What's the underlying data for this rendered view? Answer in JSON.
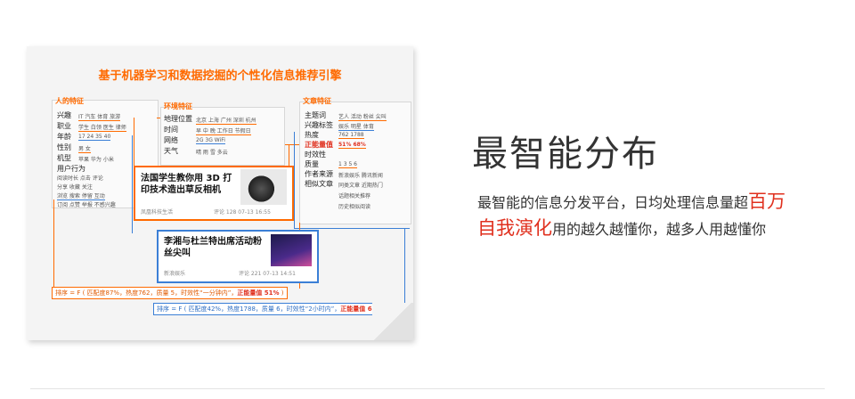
{
  "diagram": {
    "title": "基于机器学习和数据挖掘的个性化信息推荐引擎",
    "person": {
      "heading": "人的特征",
      "fields": [
        "兴趣",
        "职业",
        "年龄",
        "性别",
        "机型",
        "用户行为"
      ],
      "values": [
        "IT 汽车 体育 旅游",
        "学生 白领 医生 律师",
        "17 24 35 40",
        "男 女",
        "苹果 华为 小米",
        "",
        "阅读时长 点击 评论",
        "分享 收藏 关注",
        "浏览 搜索 停留 互动",
        "订阅 点赞 举报 不感兴趣"
      ]
    },
    "environment": {
      "heading": "环境特征",
      "fields": [
        "地理位置",
        "时间",
        "网络",
        "天气"
      ],
      "values": [
        "北京 上海 广州 深圳 杭州",
        "早 中 晚 工作日 节假日",
        "2G 3G WiFi",
        "晴 雨 雪 多云"
      ]
    },
    "article": {
      "heading": "文章特征",
      "fields": [
        "主题词",
        "兴趣标签",
        "热度",
        "正能量值",
        "时效性",
        "质量",
        "作者来源",
        "相似文章"
      ],
      "values": [
        "艺人 活动 粉丝 尖叫",
        "娱乐 明星 体育",
        "762 1788",
        "51% 68%",
        "",
        "1 3 5 6",
        "新浪娱乐 腾讯新闻",
        "同类文章 近期热门",
        "话题相关推荐",
        "历史相似阅读"
      ]
    },
    "card1": {
      "title": "法国学生教你用 3D 打印技术造出草反相机",
      "source": "凤凰科技生活",
      "meta": "评论 128  07-13 16:55"
    },
    "card2": {
      "title": "李湘与杜兰特出席活动粉丝尖叫",
      "source": "新浪娱乐",
      "meta": "评论 221  07-13 14:51"
    },
    "formula1": {
      "prefix": "排序 = F ( 匹配度87%，热度762，质量 5，时效性“一分钟内”，",
      "highlight": "正能量值 51%",
      "suffix": " )"
    },
    "formula2": {
      "prefix": "排序 = F ( 匹配度42%，热度1788，质量 6，时效性“2小时内”，",
      "highlight": "正能量值 68%",
      "suffix": " )"
    }
  },
  "heading": "最智能分布",
  "description": {
    "line1_prefix": "最智能的信息分发平台，日均处理信息量超",
    "line1_highlight": "百万",
    "line2_highlight": "自我演化",
    "line2_suffix": "用的越久越懂你，越多人用越懂你"
  },
  "colors": {
    "accent_orange": "#ff6a00",
    "accent_blue": "#3b7fd6",
    "highlight_red": "#e0301e"
  }
}
